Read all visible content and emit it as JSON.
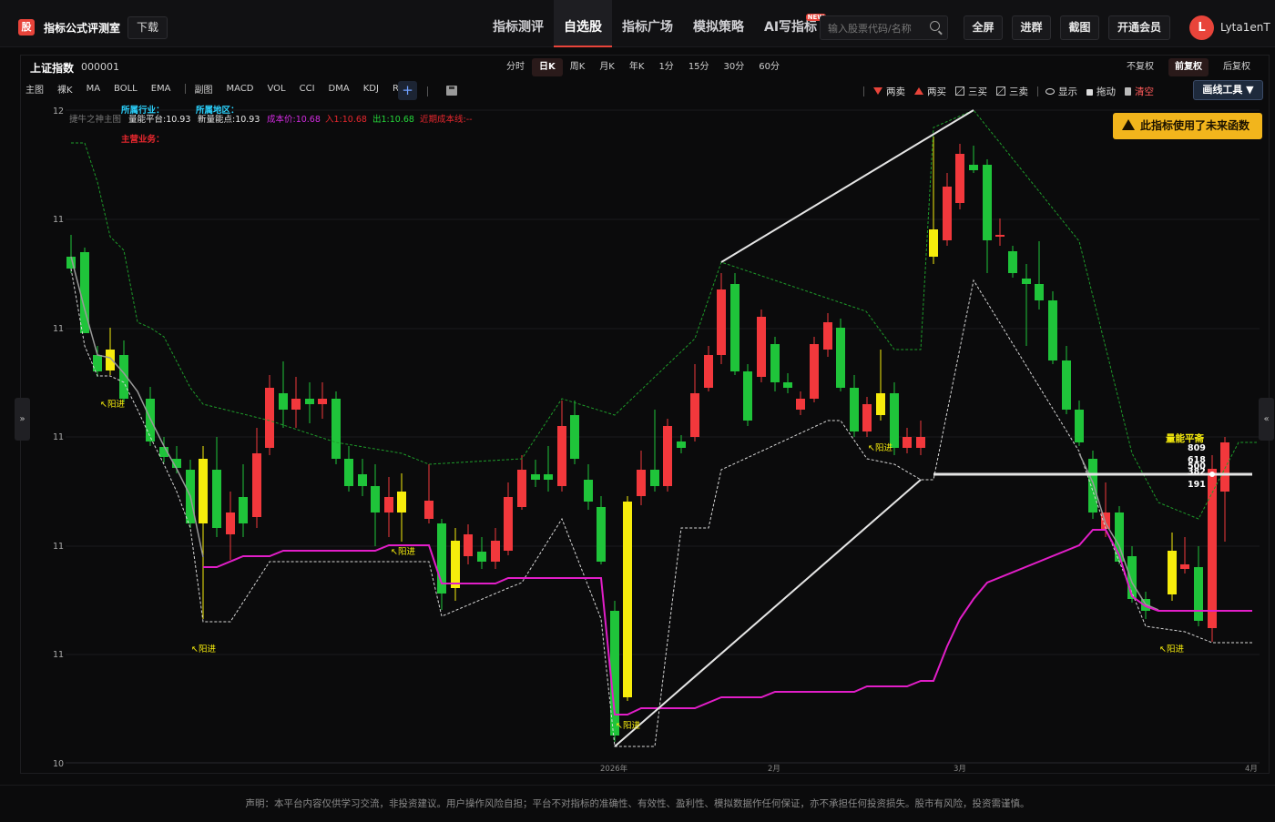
{
  "header": {
    "logo_char": "股",
    "brand": "指标公式评测室",
    "download": "下载",
    "nav": [
      {
        "label": "指标测评",
        "active": false
      },
      {
        "label": "自选股",
        "active": true
      },
      {
        "label": "指标广场",
        "active": false
      },
      {
        "label": "模拟策略",
        "active": false
      },
      {
        "label": "AI写指标",
        "active": false,
        "badge": "NEW"
      }
    ],
    "search_placeholder": "输入股票代码/名称",
    "buttons": {
      "fullscreen": "全屏",
      "join_group": "进群",
      "screenshot": "截图",
      "vip": "开通会员"
    },
    "user": {
      "avatar": "L",
      "name": "Lyta1enT"
    }
  },
  "stock": {
    "name": "上证指数",
    "code": "000001"
  },
  "periods": [
    "分时",
    "日K",
    "周K",
    "月K",
    "年K",
    "1分",
    "15分",
    "30分",
    "60分"
  ],
  "active_period": "日K",
  "adjust": [
    "不复权",
    "前复权",
    "后复权"
  ],
  "active_adjust": "前复权",
  "indicators": [
    "主图",
    "裸K",
    "MA",
    "BOLL",
    "EMA",
    "副图",
    "MACD",
    "VOL",
    "CCI",
    "DMA",
    "KDJ",
    "RSI"
  ],
  "add_label": "+",
  "draw_tools": {
    "two_sell": "两卖",
    "two_buy": "两买",
    "three_buy": "三买",
    "three_sell": "三卖",
    "show": "显示",
    "drag": "拖动",
    "clear": "清空",
    "tools": "画线工具 ▼"
  },
  "warning": "此指标使用了未来函数",
  "overlay": {
    "industry_label": "所属行业：",
    "region_label": "所属地区：",
    "main_label": "捷牛之神主图",
    "vol_platform": "量能平台:10.93",
    "new_low": "新量能点:10.93",
    "cost": "成本价:10.68",
    "entry": "入1:10.68",
    "exit": "出1:10.68",
    "recent_cost": "近期成本线:--",
    "business_label": "主营业务：",
    "signal": "↖阳进",
    "vol_flat": "量能平斋",
    "levels": [
      "809",
      "618",
      "500",
      "382",
      "191"
    ]
  },
  "axis": {
    "y_ticks": [
      "12",
      "11",
      "11",
      "11",
      "11",
      "11",
      "10"
    ],
    "x_ticks": [
      "2026年",
      "2月",
      "3月",
      "4月"
    ]
  },
  "colors": {
    "up": "#f2383c",
    "down": "#1fc43a",
    "yellow": "#f6ec0c",
    "magenta": "#e21ec8",
    "pink": "#e01a7a",
    "accent": "#e8443a"
  },
  "footer": "声明：本平台内容仅供学习交流，非投资建议。用户操作风险自担；平台不对指标的准确性、有效性、盈利性、模拟数据作任何保证，亦不承担任何投资损失。股市有风险，投资需谨慎。"
}
